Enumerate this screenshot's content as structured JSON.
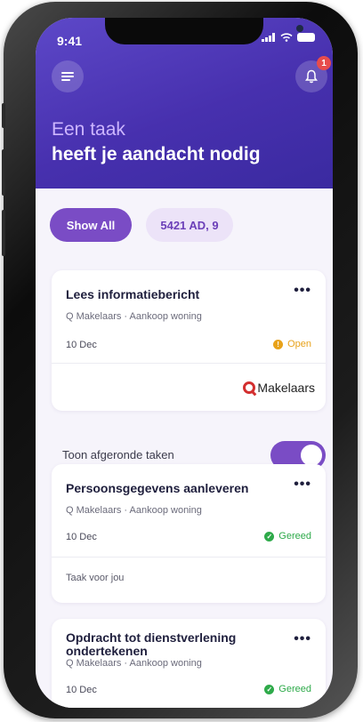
{
  "status_bar": {
    "time": "9:41"
  },
  "header": {
    "subtitle": "Een taak",
    "title": "heeft je aandacht nodig",
    "notification_count": "1"
  },
  "filters": {
    "chips": [
      "Show All",
      "5421 AD, 9"
    ]
  },
  "tasks": [
    {
      "title": "Lees informatiebericht",
      "subtitle": "Q Makelaars · Aankoop woning",
      "date": "10 Dec",
      "status": "Open",
      "status_color": "#e8a21a",
      "logo_text": "Makelaars"
    },
    {
      "title": "Persoonsgegevens aanleveren",
      "subtitle": "Q Makelaars · Aankoop woning",
      "date": "10 Dec",
      "status": "Gereed",
      "status_color": "#2eaa4a",
      "footer": "Taak voor jou"
    },
    {
      "title": "Opdracht tot dienstverlening ondertekenen",
      "subtitle": "Q Makelaars · Aankoop woning",
      "date": "10 Dec",
      "status": "Gereed",
      "status_color": "#2eaa4a"
    }
  ],
  "toggle": {
    "label": "Toon afgeronde taken",
    "on": true
  },
  "icons": {
    "menu": "hamburger-icon",
    "bell": "bell-icon",
    "more": "more-dots-icon",
    "check": "check-icon",
    "clock": "clock-icon"
  }
}
